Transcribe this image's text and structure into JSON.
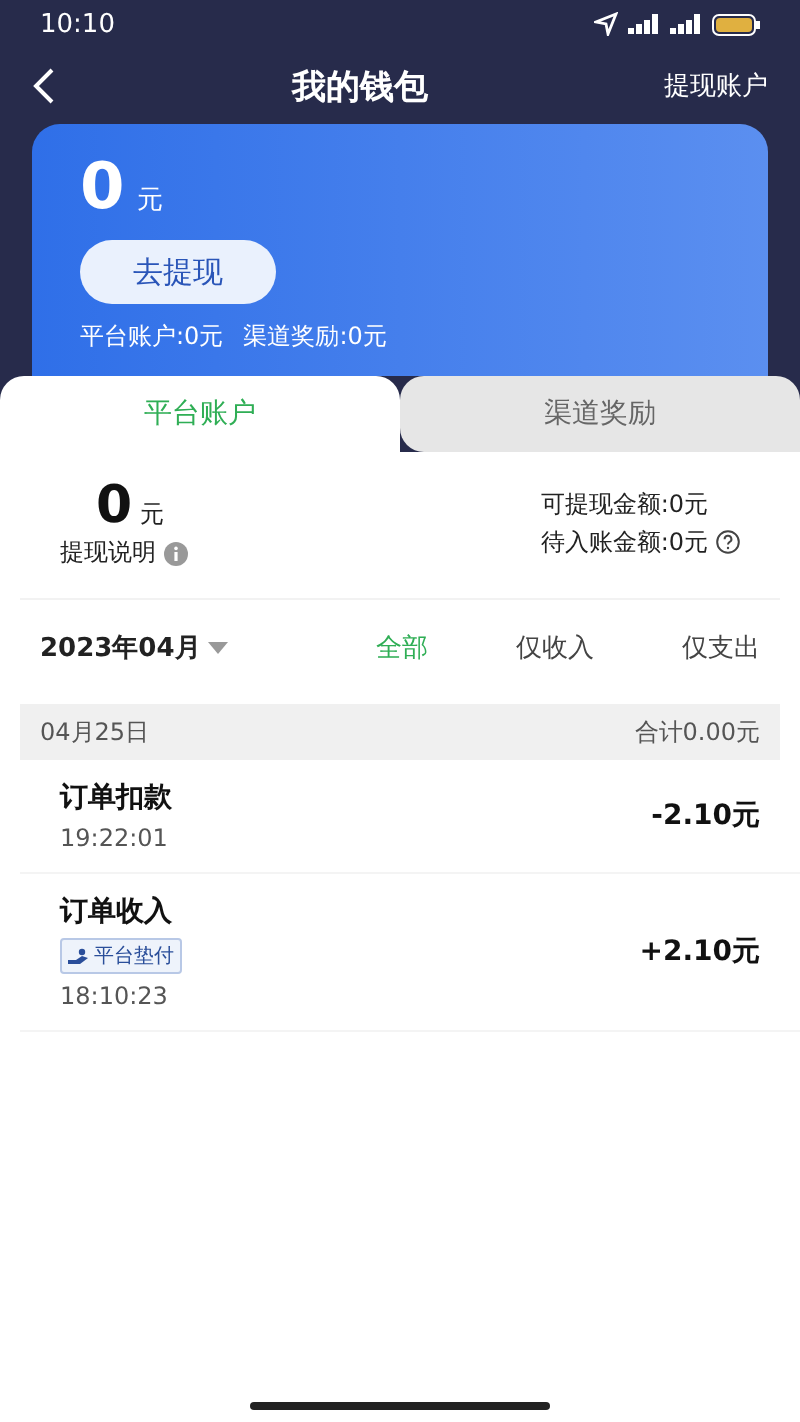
{
  "status_bar": {
    "time": "10:10"
  },
  "header": {
    "title": "我的钱包",
    "action": "提现账户"
  },
  "balance_card": {
    "amount": "0",
    "unit": "元",
    "button": "去提现",
    "summary": [
      "平台账户:0元",
      "渠道奖励:0元"
    ]
  },
  "tabs": [
    {
      "label": "平台账户",
      "selected": true
    },
    {
      "label": "渠道奖励",
      "selected": false
    }
  ],
  "account": {
    "amount": "0",
    "unit": "元",
    "note": "提现说明",
    "withdrawable": "可提现金额:0元",
    "pending": "待入账金额:0元"
  },
  "month": "2023年04月",
  "filters": [
    {
      "label": "全部",
      "selected": true
    },
    {
      "label": "仅收入",
      "selected": false
    },
    {
      "label": "仅支出",
      "selected": false
    }
  ],
  "day": {
    "date": "04月25日",
    "total": "合计0.00元"
  },
  "transactions": [
    {
      "title": "订单扣款",
      "time": "19:22:01",
      "amount": "-2.10元"
    },
    {
      "title": "订单收入",
      "tag": "平台垫付",
      "time": "18:10:23",
      "amount": "+2.10元"
    }
  ]
}
